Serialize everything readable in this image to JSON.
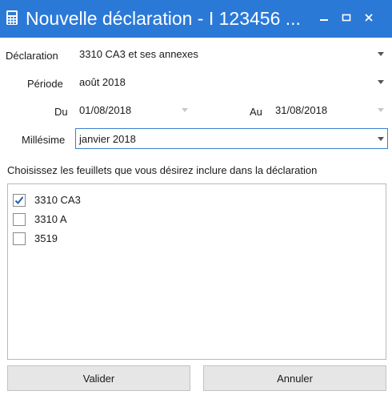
{
  "window": {
    "title": "Nouvelle déclaration - I 123456 ...",
    "icons": {
      "app": "calculator-icon",
      "minimize": "minimize-icon",
      "maximize": "maximize-icon",
      "close": "close-icon"
    }
  },
  "form": {
    "declaration": {
      "label": "Déclaration",
      "value": "3310 CA3 et ses annexes"
    },
    "periode": {
      "label": "Période",
      "value": "août 2018"
    },
    "du": {
      "label": "Du",
      "value": "01/08/2018"
    },
    "au": {
      "label": "Au",
      "value": "31/08/2018"
    },
    "millesime": {
      "label": "Millésime",
      "value": "janvier 2018"
    }
  },
  "sheets": {
    "instruction": "Choisissez les feuillets que vous désirez inclure dans la déclaration",
    "items": [
      {
        "label": "3310 CA3",
        "checked": true
      },
      {
        "label": "3310 A",
        "checked": false
      },
      {
        "label": "3519",
        "checked": false
      }
    ]
  },
  "buttons": {
    "ok": "Valider",
    "cancel": "Annuler"
  },
  "colors": {
    "titlebar": "#2b79d7",
    "focus_border": "#3a7fd0",
    "check": "#1e5fb3"
  }
}
